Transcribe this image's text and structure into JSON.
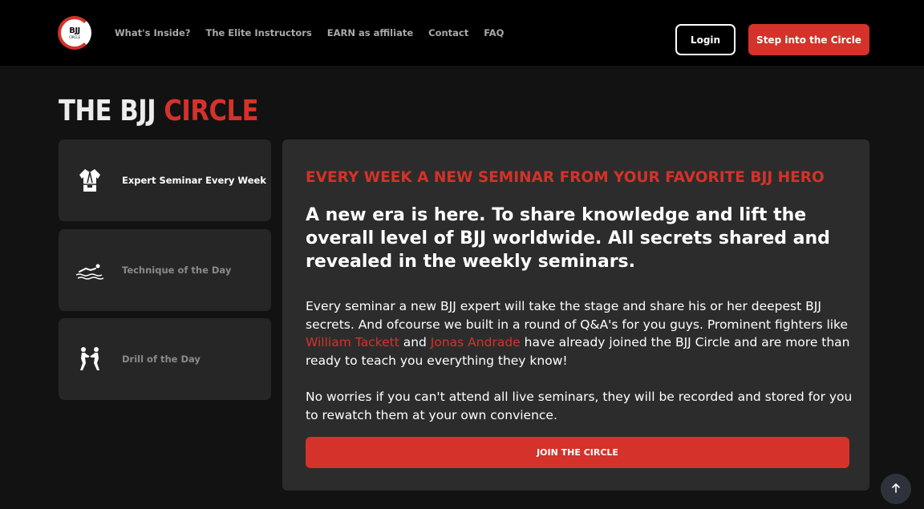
{
  "header": {
    "logo": {
      "line1": "BJJ",
      "line2": "CIRCLE"
    },
    "nav": [
      {
        "label": "What's Inside?"
      },
      {
        "label": "The Elite Instructors"
      },
      {
        "label": "EARN as affiliate"
      },
      {
        "label": "Contact"
      },
      {
        "label": "FAQ"
      }
    ],
    "login_label": "Login",
    "cta_label": "Step into the Circle"
  },
  "brand": {
    "white": "THE BJJ ",
    "red": "CIRCLE"
  },
  "sidebar": {
    "items": [
      {
        "label": "Expert Seminar Every Week",
        "icon": "gi-icon",
        "active": true
      },
      {
        "label": "Technique of the Day",
        "icon": "swimmer-icon",
        "active": false
      },
      {
        "label": "Drill of the Day",
        "icon": "grappling-icon",
        "active": false
      }
    ]
  },
  "main": {
    "kicker": "EVERY WEEK A NEW SEMINAR FROM YOUR FAVORITE BJJ HERO",
    "headline": "A new era is here. To share knowledge and lift the overall level of BJJ worldwide. All secrets shared and revealed in the weekly seminars.",
    "body1": {
      "part1": "Every seminar a new BJJ expert will take the stage and share his or her deepest BJJ secrets. And ofcourse we built in a round of Q&A's for you guys. Prominent fighters like ",
      "name1": "William Tackett",
      "part2": " and ",
      "name2": "Jonas Andrade",
      "part3": " have already joined the BJJ Circle and are more than ready to teach you everything they know!"
    },
    "body2": "No worries if you can't attend all live seminars, they will be recorded and stored for you to rewatch them at your own convience.",
    "join_label": "JOIN THE CIRCLE"
  },
  "colors": {
    "accent": "#d4322a",
    "background": "#121212",
    "header": "#000000",
    "card": "#262626",
    "panel": "#2c2c2c"
  }
}
